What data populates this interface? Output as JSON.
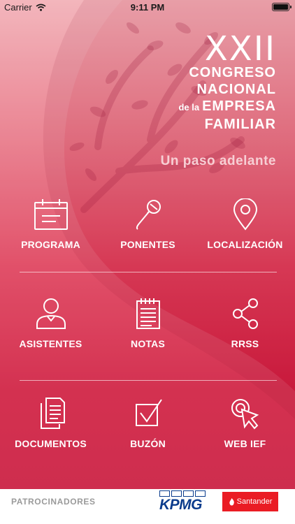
{
  "status_bar": {
    "carrier": "Carrier",
    "time": "9:11 PM"
  },
  "header": {
    "numeral": "XXII",
    "line1": "CONGRESO",
    "line2": "NACIONAL",
    "line3_prefix": "de la",
    "line3": "EMPRESA",
    "line4": "FAMILIAR",
    "tagline": "Un paso adelante"
  },
  "menu": {
    "programa": "PROGRAMA",
    "ponentes": "PONENTES",
    "localizacion": "LOCALIZACIÓN",
    "asistentes": "ASISTENTES",
    "notas": "NOTAS",
    "rrss": "RRSS",
    "documentos": "DOCUMENTOS",
    "buzon": "BUZÓN",
    "web": "WEB IEF"
  },
  "footer": {
    "sponsors_label": "PATROCINADORES",
    "kpmg": "KPMG",
    "santander": "Santander"
  },
  "colors": {
    "brand_red": "#d42345",
    "kpmg_blue": "#0a3b8c",
    "santander_red": "#ea1c24"
  },
  "icons": [
    "wifi-icon",
    "battery-icon",
    "calendar-icon",
    "microphone-icon",
    "location-pin-icon",
    "user-icon",
    "notepad-icon",
    "share-icon",
    "documents-icon",
    "checkbox-icon",
    "cursor-click-icon",
    "santander-flame-icon"
  ]
}
